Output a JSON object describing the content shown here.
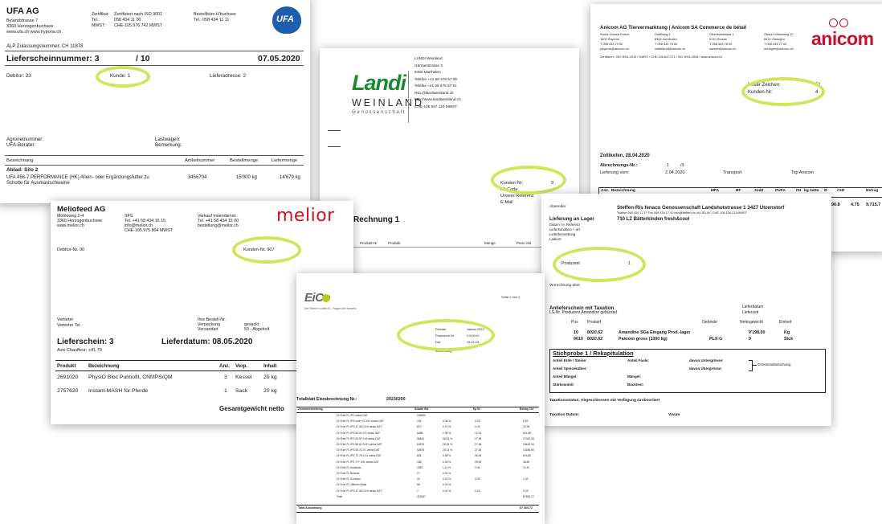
{
  "ufa": {
    "company": "UFA AG",
    "addr1": "Bylandstrasse 7",
    "addr2": "3360 Herzogenbuchsee",
    "web": "www.ufa.ch   www.hypona.ch",
    "cert_labels": [
      "Zertifikat:",
      "Tel.:",
      "MWST:"
    ],
    "cert_values": [
      "Zertifiziert nach ISO 9001",
      "058 434 11 00",
      "CHE-105.976.742 MWST"
    ],
    "order_label": "Bestellbüro H'buchsee",
    "order_tel": "Tel.:  058 434 11 11",
    "logo": "UFA",
    "alp": "ALP Zulassungsnummer: CH 11878",
    "lieferschein": "Lieferscheinnummer: 3",
    "of": "/ 10",
    "date": "07.05.2020",
    "debitor": "Debitor: 23",
    "kunde": "Kunde: 1",
    "lieferadresse": "Lieferadresse: 2",
    "agronet": "Agronetnummer:",
    "berater": "UFA-Berater:",
    "lastwagen": "Lastwagen:",
    "bemerkung": "Bemerkung:",
    "cols": [
      "Bezeichnung",
      "Artikelnummer",
      "Bestellmenge",
      "Liefermenge"
    ],
    "ablad": "Ablad: Silo 2",
    "item": "UFA 456-7 PERFORMANCE (HK) Allein- oder Ergänzungsfutter zu",
    "item2": "Schotte für Ausmastschweine",
    "artnr": "3456704",
    "bestell": "15'000 kg",
    "liefer": "14'679 kg"
  },
  "landi": {
    "logo_top": "Landi",
    "logo_bottom": "WEINLAND",
    "logo_sub": "Genossenschaft",
    "info": [
      "LANDI Weinland",
      "Gärtnerstrasse 3",
      "8450 Marthalen",
      "Telefon +41 58 476 57 00",
      "Telefax +41 58 476 57 01",
      "REL@landiweinland.ch",
      "http://www.landiweinland.ch",
      "CHE-105.947.120 MWST"
    ],
    "kunden_nr": "Kunden-Nr:",
    "kunden_val": "9",
    "alt_code": "Alt-Code",
    "referenz": "Unsere Referenz",
    "email": "E-Mail",
    "rechnung": "Rechnung 1",
    "cols": [
      "Produkt-Nr",
      "Produkt",
      "Menge",
      "Preis inkl."
    ]
  },
  "anicom": {
    "header": "Anicom AG Tiervermarktung | Anicom SA Commerce de bétail",
    "addr": [
      [
        "Route Grosse-Ferme",
        "1800 Payerne",
        "T 058 433 79 50",
        "payerne@anicom.ch"
      ],
      [
        "Dörfliweg 4",
        "8302 Zumikofen",
        "T 058 433 79 00",
        "mittelland@anicom.ch"
      ],
      [
        "Oberfeldstrasse 1",
        "6210 Sursee",
        "T 058 433 78 00",
        "sursee@anicom.ch"
      ],
      [
        "Oberer Wisenweg 22",
        "8432 Ohringen",
        "T 058 433 77 00",
        "ohringen@anicom.ch"
      ]
    ],
    "footer_line": "Zertifiziert / ISO 9001:2015 / MWST / CHE-105.847.271 / ISO 9001:2008 / www.anicom.ch",
    "logo": "anicom",
    "zeichen": "Unser Zeichen:",
    "zeichen_val": "51",
    "kunden": "Kunden-Nr:",
    "kunden_val": "4",
    "place_date": "Zollikofen,   28.04.2020",
    "abr": "Abrechnungs-Nr.:",
    "abr_val": "1",
    "abr_of": "/3",
    "lieferung": "Lieferung vom:",
    "lieferung_val": "2.04.2020",
    "transport": "Transport",
    "tsp": "Tsp Anicom",
    "cols": [
      "Anz.",
      "Bezeichnung",
      "MFA",
      "BF",
      "JodZ",
      "PUFA",
      "FH",
      "kg netto",
      "Ø",
      "CHF",
      "Betrag"
    ],
    "row_vals": [
      "90.8",
      "4.75",
      "9,715.7"
    ]
  },
  "melior": {
    "company": "Meliofeed AG",
    "addr": [
      "Mühleweg 2-4",
      "3360 Herzogenbuchsee",
      "www.melior.ch"
    ],
    "sfs": [
      "SFS",
      "Tel. +41 58 434 15 15",
      "info@melior.ch",
      "CHE-105.975.804 MWST"
    ],
    "verkauf": [
      "Verkauf Innendienst:",
      "Tel. +41 58 434 15 00",
      "bestellung@melior.ch"
    ],
    "logo": "melior",
    "debitor": "Debitor-Nr. 90",
    "kunden": "Kunden-Nr. 907",
    "vertreter": [
      "Vertreter",
      "Vertreter Tel."
    ],
    "bestell": [
      "Ihre Bestell-Nr.",
      "Verpackung",
      "Versandart"
    ],
    "bestell_vals": [
      "",
      "gesackt",
      "50 - Abgeholt"
    ],
    "lieferschein": "Lieferschein: 3",
    "chauffeur": "Avis Chauffeur: +41 79",
    "lieferdatum": "Lieferdatum: 08.05.2020",
    "cols": [
      "Produkt",
      "Bezeichnung",
      "Anz.",
      "Verp.",
      "Inhalt"
    ],
    "rows": [
      [
        "2691020",
        "PhysiO Bloc Pulmofit, CNf/IPS/QM",
        "3",
        "Kessel",
        "20 kg"
      ],
      [
        "2757620",
        "Instant-MASH für Pferde",
        "1",
        "Sack",
        "20 kg"
      ]
    ],
    "total": "Gesamtgewicht netto"
  },
  "gico": {
    "logo": "EiCo",
    "slogan": "Der Partner in allen Ei - Fragen der Schweiz",
    "seite": "Seite 1 von 1",
    "fields": [
      [
        "Periode",
        "Januar 2023"
      ],
      [
        "Produzent Nr.",
        "XXXXXX"
      ],
      [
        "Dat.",
        "15.02.23"
      ]
    ],
    "bem": "Bemerkung",
    "total_title": "Totalblatt Eierabrechnung Nr.:",
    "total_nr": "20230200",
    "cols": [
      "Zusammensetzung",
      "Anzahl Stk",
      "",
      "Ep.St",
      "Betrag Chf"
    ],
    "rows": [
      [
        "CH Eier FL IPS weiss DAT",
        "234500",
        "",
        "",
        ""
      ],
      [
        "CH Eier FL IPS unter 47.XXL weiss DAT",
        "154",
        "0.06 %",
        "3.05",
        "5.52"
      ],
      [
        "CH Eier FL IPS 47-49.0 XS weiss DAT",
        "872",
        "0.37 %",
        "4.03",
        "22.93"
      ],
      [
        "CH Eier FL IPS 50-52.9 S weiss DAT",
        "6456",
        "2.98 %",
        "12.04",
        "601.66"
      ],
      [
        "CH Eier FL IPS 53-57.9 M weiss DAT",
        "98461",
        "45.81 %",
        "27.45",
        "27020.35"
      ],
      [
        "CH Eier FL IPS 58-62.9 M+ weiss DAT",
        "64976",
        "28.25 %",
        "27.45",
        "18440.16"
      ],
      [
        "CH Eier FL IPS 63-71.9 L weiss DAT",
        "52879",
        "24.12 %",
        "27.45",
        "14236.90"
      ],
      [
        "CH Eier FL IPS 72-75.9 XL weiss DAT",
        "826",
        "0.38 %",
        "26.05",
        "215.80"
      ],
      [
        "CH Eier FL IPS 77+ XXL weiss DAT",
        "168",
        "0.08 %",
        "29.05",
        "48.69"
      ],
      [
        "CH Eier FL Knickeier",
        "2387",
        "1.11 %",
        "3.05",
        "71.87"
      ],
      [
        "CH Eier FL Bruteier",
        "27",
        "0.01 %",
        "",
        ""
      ],
      [
        "CH Eier FL Schmutz",
        "44",
        "0.02 %",
        "3.03",
        "1.32"
      ],
      [
        "CH Eier FL Offenes Brust",
        "58",
        "0.03 %",
        "",
        ""
      ],
      [
        "CH Eier FL IPS 47-49.0 XS weiss DAT",
        "7",
        "0.00 %",
        "4.14",
        "0.29"
      ],
      [
        "Total",
        "215947",
        "",
        "",
        "87460.72"
      ]
    ],
    "footer": [
      "Total Auszahlung",
      "",
      "",
      "",
      "87 460.72"
    ]
  },
  "fenaco": {
    "absender": "Absender",
    "company": "Steffen-Ris  fenaco Genossenschaft  Landshutstrasse 1  3427  Utzenstorf",
    "contact": "Telefon 058 434 17 17   Fax 058 434 17 00   info@steffen-ris.ch   UID-Nr.: CHE-106.106.123 MWST",
    "lager": "Lieferung an Lager",
    "lager_val": "710 LZ Bätterkinden fresh&cool",
    "left_labels": [
      "Datum / e. Referenz",
      "Lieferkondition / -art",
      "Lieferbemerkung",
      "Ladeort"
    ],
    "produzent": "Produzent",
    "produzent_val": "1",
    "verrechnung": "Verrechnung über",
    "anlief": "Anlieferschein mit Taxation",
    "lsnr": "LS-Nr. Produzent  Amandine gebürstet",
    "lieferdatum": "Lieferdatum",
    "lieferzeit": "Lieferzeit",
    "cols": [
      "Pos",
      "Produkt",
      "Gebinde",
      "Nettogewicht",
      "Einheit"
    ],
    "rows": [
      [
        "10",
        "8020.62",
        "Amandine SGa Eingang Prod.-lager",
        "",
        "9'198.00",
        "Kg"
      ],
      [
        "9010",
        "8020.62",
        "Paloxen gross (1000 kg)",
        "PLX-G",
        "9",
        "Stck"
      ]
    ],
    "stich": "Stichprobe 1 / Rekapitulation",
    "grid": [
      [
        "Anteil Erde / Steine:",
        "Anteil Faule:",
        "davon Untergrösse:"
      ],
      [
        "Anteil Speisekalber:",
        "",
        "davon Übergrösse:"
      ],
      [
        "Anteil Mängel:",
        "Mängel:",
        ""
      ],
      [
        "Stärkeanteil:",
        "Backtest:",
        ""
      ]
    ],
    "grossen": "Grössenabweichung:",
    "taxstatus": "Taxationsstatus: Abgeschlossen mit Verfügung Grobsortiert",
    "taxdatum": "Taxation Datum:",
    "visum": "Visum"
  }
}
